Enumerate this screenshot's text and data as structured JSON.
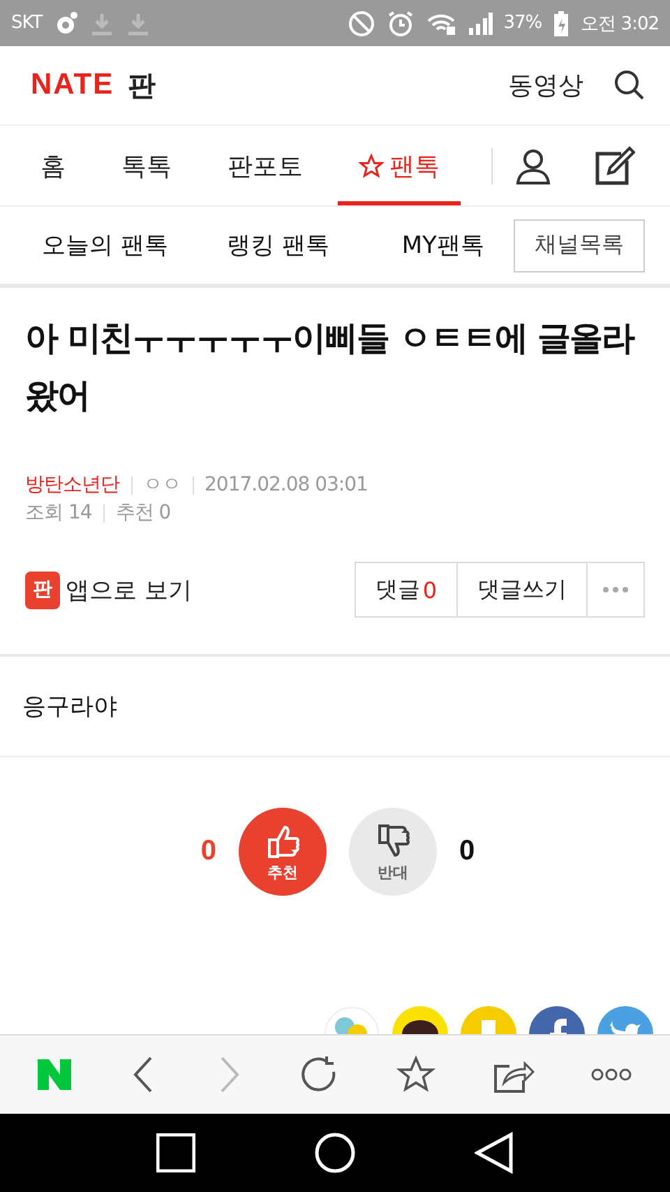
{
  "status_bar": {
    "carrier": "SKT",
    "battery": "37%",
    "time": "오전 3:02"
  },
  "header": {
    "logo": "NATE",
    "logo_suffix": "판",
    "video_link": "동영상"
  },
  "tabs": [
    {
      "label": "홈",
      "selected": false
    },
    {
      "label": "톡톡",
      "selected": false
    },
    {
      "label": "판포토",
      "selected": false
    },
    {
      "label": "팬톡",
      "selected": true
    }
  ],
  "subnav": {
    "items": [
      "오늘의 팬톡",
      "랭킹 팬톡",
      "MY팬톡"
    ],
    "channel_button": "채널목록"
  },
  "post": {
    "title": "아 미친ㅜㅜㅜㅜㅜ이삐들 ㅇㅌㅌ에 글올라왔어",
    "channel": "방탄소년단",
    "author": "ㅇㅇ",
    "date": "2017.02.08 03:01",
    "views": "조회 14",
    "recommends": "추천 0",
    "app_badge": "판",
    "app_link": "앱으로 보기",
    "comments_label": "댓글",
    "comments": "0",
    "write_comment": "댓글쓰기",
    "body": "응구라야"
  },
  "vote": {
    "up_count": "0",
    "up_label": "추천",
    "down_label": "반대",
    "down_count": "0"
  },
  "browser_toolbar": {
    "forward_disabled": true
  }
}
